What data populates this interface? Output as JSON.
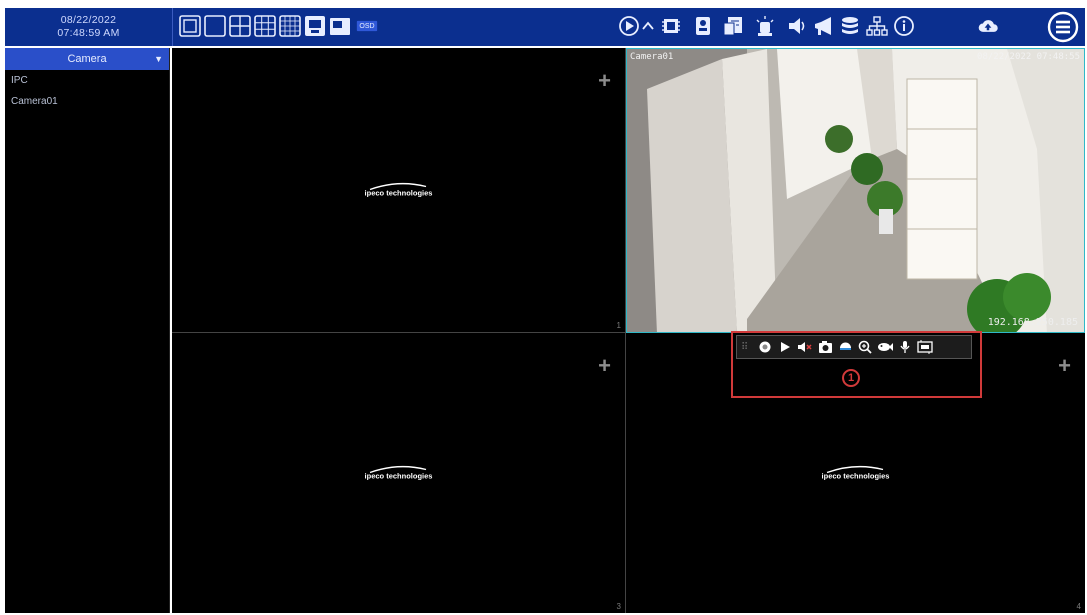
{
  "header": {
    "date": "08/22/2022",
    "time": "07:48:59 AM",
    "osd_label": "OSD"
  },
  "sidebar": {
    "title": "Camera",
    "items": [
      {
        "label": "IPC"
      },
      {
        "label": "Camera01"
      }
    ]
  },
  "grid": {
    "cells": [
      {
        "number": "1",
        "logo": "ipeco technologies",
        "plus": "+"
      },
      {
        "number": "2",
        "camera_name": "Camera01",
        "timestamp": "08/22/2022 07:48:55",
        "ip": "192.168.250.185"
      },
      {
        "number": "3",
        "logo": "ipeco technologies",
        "plus": "+"
      },
      {
        "number": "4",
        "logo": "ipeco technologies",
        "plus": "+"
      }
    ]
  },
  "callout": {
    "number": "1"
  },
  "colors": {
    "topbar": "#0b2f8f",
    "sidebar_header": "#2a4fc9",
    "callout": "#d13a3a",
    "selected_border": "#2fb8c7"
  }
}
